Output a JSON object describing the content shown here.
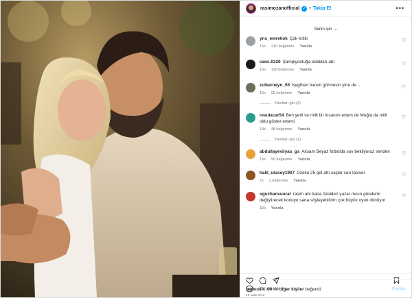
{
  "header": {
    "username": "rasimozanofficial",
    "verified_mark": "✓",
    "separator": "•",
    "follow_label": "Takip Et",
    "more_label": "•••"
  },
  "section_label": "Senin için",
  "comments": [
    {
      "user": "yns_emrekok",
      "text": "Çok kritik",
      "time": "15s",
      "likes": "210 beğenme",
      "reply": "Yanıtla",
      "avatar_color": "#9aa0a6"
    },
    {
      "user": "canc.0320",
      "text": "Şampiyonluğa odakları abi",
      "time": "15s",
      "likes": "116 beğenme",
      "reply": "Yanıtla",
      "avatar_color": "#1a1a1a"
    },
    {
      "user": "zulkarneyn_55",
      "text": "Nagihan hanım görmesin yine de ..",
      "time": "15s",
      "likes": "55 beğenme",
      "reply": "Yanıtla",
      "avatar_color": "#6b705c",
      "view_replies": "Yanıtları gör (3)"
    },
    {
      "user": "resulacar54",
      "text": "Ben yerli ve milli bir insanım ertem de Muğla da milli oldu göster ertemi",
      "time": "14s",
      "likes": "48 beğenme",
      "reply": "Yanıtla",
      "avatar_color": "#2a9d8f",
      "view_replies": "Yanıtları gör (1)"
    },
    {
      "user": "abdullayevilyas_gs",
      "text": "Aksam Beyaz futbolda sov bekliyoruz senden",
      "time": "15s",
      "likes": "56 beğenme",
      "reply": "Yanıtla",
      "avatar_color": "#e9a23b"
    },
    {
      "user": "halil_ulusoy1907",
      "text": "Dzeko 25 gol attı saçlar sarı laciver",
      "time": "7s",
      "likes": "2 beğenme",
      "reply": "Yanıtla",
      "avatar_color": "#8d5524"
    },
    {
      "user": "oguzhanvuural",
      "text": "rasim abi bana özelden yazar mısın gündemi değiştirecek konuyu sana söyleyebilirim çok büyük oyun dönüyor",
      "time": "15s",
      "likes": "",
      "reply": "Yanıtla",
      "avatar_color": "#c0392b"
    }
  ],
  "likes_line": {
    "user": "berkcelik_00",
    "middle": " ve ",
    "others": "diğer kişiler",
    "suffix": " beğendi"
  },
  "time_ago": "15 saat önce",
  "comment_input": {
    "placeholder": "Yorum ekle...",
    "post_label": "Paylaş"
  },
  "icons": {
    "heart": "heart-icon",
    "comment": "comment-icon",
    "share": "share-icon",
    "save": "bookmark-icon",
    "emoji": "emoji-icon",
    "more": "more-icon"
  },
  "colors": {
    "accent": "#0095f6",
    "border": "#dbdbdb",
    "muted": "#737373"
  }
}
